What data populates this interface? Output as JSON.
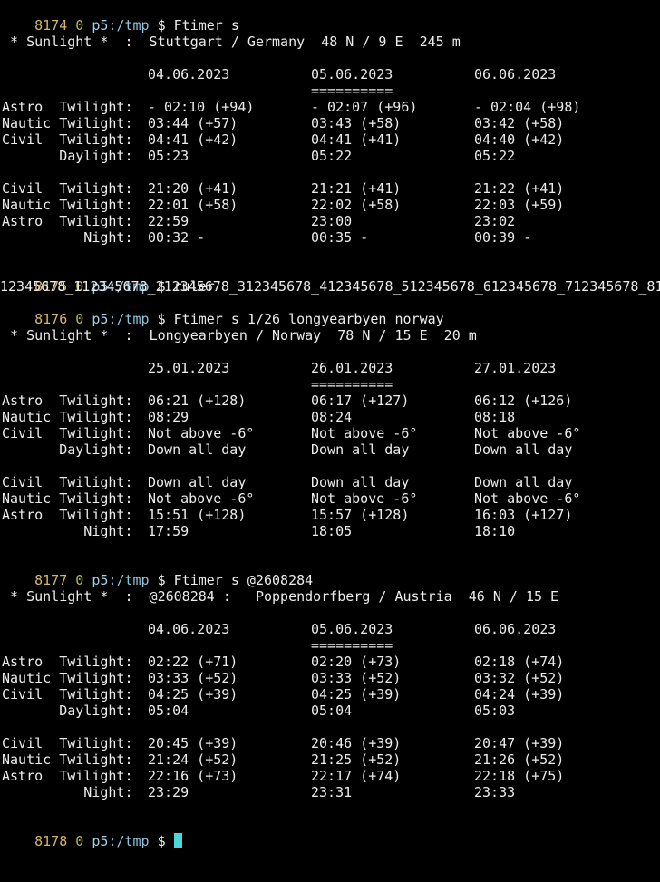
{
  "colors": {
    "background": "#000000",
    "text": "#ececec",
    "history_number": "#d4b56a",
    "exit_status": "#b8bf3c",
    "host": "#9dd3ea",
    "cursor": "#4cd6d6"
  },
  "prompts": [
    {
      "num": "8174",
      "status": "0",
      "host": "p5:",
      "path": "/tmp",
      "symbol": "$",
      "command": "Ftimer s"
    },
    {
      "num": "8175",
      "status": "0",
      "host": "p5:",
      "path": "/tmp",
      "symbol": "$",
      "command": "ruler"
    },
    {
      "num": "8176",
      "status": "0",
      "host": "p5:",
      "path": "/tmp",
      "symbol": "$",
      "command": "Ftimer s 1/26 longyearbyen norway"
    },
    {
      "num": "8177",
      "status": "0",
      "host": "p5:",
      "path": "/tmp",
      "symbol": "$",
      "command": "Ftimer s @2608284"
    },
    {
      "num": "8178",
      "status": "0",
      "host": "p5:",
      "path": "/tmp",
      "symbol": "$",
      "command": ""
    }
  ],
  "ruler_output": "12345678_112345678_212345678_312345678_412345678_512345678_612345678_712345678_81",
  "reports": [
    {
      "header": " * Sunlight *  :  Stuttgart / Germany  48 N / 9 E  245 m",
      "dates": [
        "04.06.2023",
        "05.06.2023",
        "06.06.2023"
      ],
      "underline": [
        "",
        "==========",
        ""
      ],
      "rows": [
        {
          "label": "Astro  Twilight:",
          "values": [
            "- 02:10 (+94)",
            "- 02:07 (+96)",
            "- 02:04 (+98)"
          ]
        },
        {
          "label": "Nautic Twilight:",
          "values": [
            "03:44 (+57)",
            "03:43 (+58)",
            "03:42 (+58)"
          ]
        },
        {
          "label": "Civil  Twilight:",
          "values": [
            "04:41 (+42)",
            "04:41 (+41)",
            "04:40 (+42)"
          ]
        },
        {
          "label": "       Daylight:",
          "values": [
            "05:23",
            "05:22",
            "05:22"
          ]
        },
        {
          "label": "Civil  Twilight:",
          "values": [
            "21:20 (+41)",
            "21:21 (+41)",
            "21:22 (+41)"
          ]
        },
        {
          "label": "Nautic Twilight:",
          "values": [
            "22:01 (+58)",
            "22:02 (+58)",
            "22:03 (+59)"
          ]
        },
        {
          "label": "Astro  Twilight:",
          "values": [
            "22:59",
            "23:00",
            "23:02"
          ]
        },
        {
          "label": "          Night:",
          "values": [
            "00:32 -",
            "00:35 -",
            "00:39 -"
          ]
        }
      ]
    },
    {
      "header": " * Sunlight *  :  Longyearbyen / Norway  78 N / 15 E  20 m",
      "dates": [
        "25.01.2023",
        "26.01.2023",
        "27.01.2023"
      ],
      "underline": [
        "",
        "==========",
        ""
      ],
      "rows": [
        {
          "label": "Astro  Twilight:",
          "values": [
            "06:21 (+128)",
            "06:17 (+127)",
            "06:12 (+126)"
          ]
        },
        {
          "label": "Nautic Twilight:",
          "values": [
            "08:29",
            "08:24",
            "08:18"
          ]
        },
        {
          "label": "Civil  Twilight:",
          "values": [
            "Not above -6°",
            "Not above -6°",
            "Not above -6°"
          ]
        },
        {
          "label": "       Daylight:",
          "values": [
            "Down all day",
            "Down all day",
            "Down all day"
          ]
        },
        {
          "label": "Civil  Twilight:",
          "values": [
            "Down all day",
            "Down all day",
            "Down all day"
          ]
        },
        {
          "label": "Nautic Twilight:",
          "values": [
            "Not above -6°",
            "Not above -6°",
            "Not above -6°"
          ]
        },
        {
          "label": "Astro  Twilight:",
          "values": [
            "15:51 (+128)",
            "15:57 (+128)",
            "16:03 (+127)"
          ]
        },
        {
          "label": "          Night:",
          "values": [
            "17:59",
            "18:05",
            "18:10"
          ]
        }
      ]
    },
    {
      "header": " * Sunlight *  :  @2608284 :   Poppendorfberg / Austria  46 N / 15 E",
      "dates": [
        "04.06.2023",
        "05.06.2023",
        "06.06.2023"
      ],
      "underline": [
        "",
        "==========",
        ""
      ],
      "rows": [
        {
          "label": "Astro  Twilight:",
          "values": [
            "02:22 (+71)",
            "02:20 (+73)",
            "02:18 (+74)"
          ]
        },
        {
          "label": "Nautic Twilight:",
          "values": [
            "03:33 (+52)",
            "03:33 (+52)",
            "03:32 (+52)"
          ]
        },
        {
          "label": "Civil  Twilight:",
          "values": [
            "04:25 (+39)",
            "04:25 (+39)",
            "04:24 (+39)"
          ]
        },
        {
          "label": "       Daylight:",
          "values": [
            "05:04",
            "05:04",
            "05:03"
          ]
        },
        {
          "label": "Civil  Twilight:",
          "values": [
            "20:45 (+39)",
            "20:46 (+39)",
            "20:47 (+39)"
          ]
        },
        {
          "label": "Nautic Twilight:",
          "values": [
            "21:24 (+52)",
            "21:25 (+52)",
            "21:26 (+52)"
          ]
        },
        {
          "label": "Astro  Twilight:",
          "values": [
            "22:16 (+73)",
            "22:17 (+74)",
            "22:18 (+75)"
          ]
        },
        {
          "label": "          Night:",
          "values": [
            "23:29",
            "23:31",
            "23:33"
          ]
        }
      ]
    }
  ]
}
